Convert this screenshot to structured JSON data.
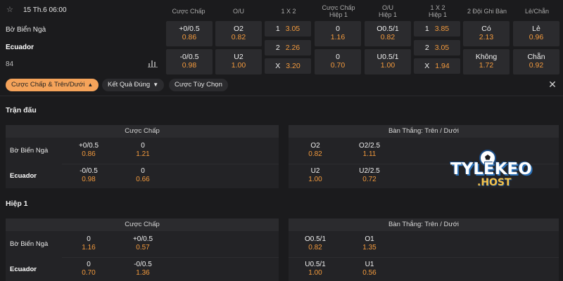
{
  "match": {
    "date": "15 Th.6 06:00",
    "home": "Bờ Biển Ngà",
    "away": "Ecuador",
    "more_markets": "84"
  },
  "columns": [
    {
      "label": "Cược Chấp",
      "label2": ""
    },
    {
      "label": "O/U",
      "label2": ""
    },
    {
      "label": "1 X 2",
      "label2": ""
    },
    {
      "label": "Cược Chấp",
      "label2": "Hiệp 1"
    },
    {
      "label": "O/U",
      "label2": "Hiệp 1"
    },
    {
      "label": "1 X 2",
      "label2": "Hiệp 1"
    },
    {
      "label": "2 Đội Ghi Bàn",
      "label2": ""
    },
    {
      "label": "Lẻ/Chẵn",
      "label2": ""
    }
  ],
  "odds": {
    "hcap": [
      {
        "line": "+0/0.5",
        "odd": "0.86"
      },
      {
        "line": "-0/0.5",
        "odd": "0.98"
      }
    ],
    "ou": [
      {
        "line": "O2",
        "odd": "0.82"
      },
      {
        "line": "U2",
        "odd": "1.00"
      }
    ],
    "x12": [
      {
        "lab": "1",
        "odd": "3.05"
      },
      {
        "lab": "2",
        "odd": "2.26"
      },
      {
        "lab": "X",
        "odd": "3.20"
      }
    ],
    "h1_hcap": [
      {
        "line": "0",
        "odd": "1.16"
      },
      {
        "line": "0",
        "odd": "0.70"
      }
    ],
    "h1_ou": [
      {
        "line": "O0.5/1",
        "odd": "0.82"
      },
      {
        "line": "U0.5/1",
        "odd": "1.00"
      }
    ],
    "h1_x12": [
      {
        "lab": "1",
        "odd": "3.85"
      },
      {
        "lab": "2",
        "odd": "3.05"
      },
      {
        "lab": "X",
        "odd": "1.94"
      }
    ],
    "btts": [
      {
        "line": "Có",
        "odd": "2.13"
      },
      {
        "line": "Không",
        "odd": "1.72"
      }
    ],
    "oddeven": [
      {
        "line": "Lẻ",
        "odd": "0.96"
      },
      {
        "line": "Chẵn",
        "odd": "0.92"
      }
    ]
  },
  "filters": {
    "chip1": "Cược Chấp & Trên/Dưới",
    "chip2": "Kết Quả Đúng",
    "chip3": "Cược Tùy Chọn",
    "close": "✕"
  },
  "full_match": {
    "title": "Trận đấu",
    "left_header": "Cược Chấp",
    "right_header": "Bàn Thắng: Trên / Dưới",
    "home": "Bờ Biển Ngà",
    "away": "Ecuador",
    "left": [
      [
        {
          "line": "+0/0.5",
          "odd": "0.86"
        },
        {
          "line": "0",
          "odd": "1.21"
        }
      ],
      [
        {
          "line": "-0/0.5",
          "odd": "0.98"
        },
        {
          "line": "0",
          "odd": "0.66"
        }
      ]
    ],
    "right": [
      [
        {
          "line": "O2",
          "odd": "0.82"
        },
        {
          "line": "O2/2.5",
          "odd": "1.11"
        }
      ],
      [
        {
          "line": "U2",
          "odd": "1.00"
        },
        {
          "line": "U2/2.5",
          "odd": "0.72"
        }
      ]
    ]
  },
  "half1": {
    "title": "Hiệp 1",
    "left_header": "Cược Chấp",
    "right_header": "Bàn Thắng: Trên / Dưới",
    "home": "Bờ Biển Ngà",
    "away": "Ecuador",
    "left": [
      [
        {
          "line": "0",
          "odd": "1.16"
        },
        {
          "line": "+0/0.5",
          "odd": "0.57"
        }
      ],
      [
        {
          "line": "0",
          "odd": "0.70"
        },
        {
          "line": "-0/0.5",
          "odd": "1.36"
        }
      ]
    ],
    "right": [
      [
        {
          "line": "O0.5/1",
          "odd": "0.82"
        },
        {
          "line": "O1",
          "odd": "1.35"
        }
      ],
      [
        {
          "line": "U0.5/1",
          "odd": "1.00"
        },
        {
          "line": "U1",
          "odd": "0.56"
        }
      ]
    ]
  },
  "watermark": {
    "main": "TYLEKEO",
    "sub": ".HOST"
  },
  "colors": {
    "odd": "#f39a3d",
    "active_chip": "#f5a35a",
    "cell_bg": "#2b2b2e"
  }
}
